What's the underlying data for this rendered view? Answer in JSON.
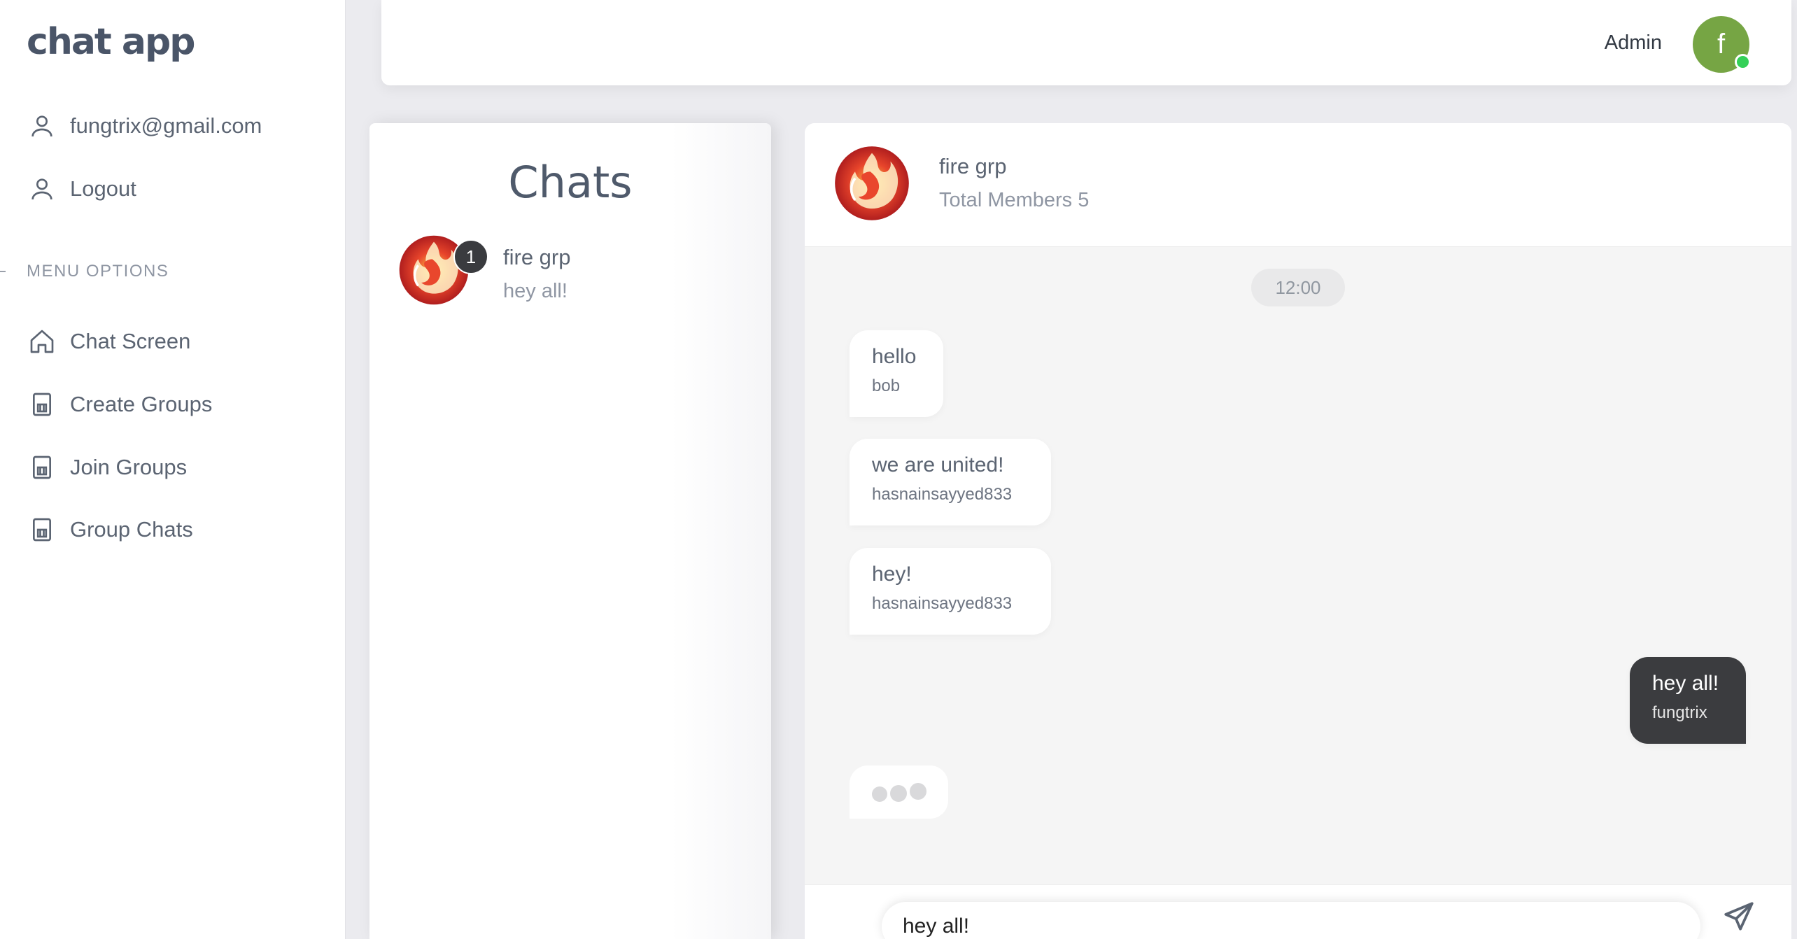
{
  "app": {
    "brand": "chat app"
  },
  "sidebar": {
    "user_email": "fungtrix@gmail.com",
    "logout_label": "Logout",
    "menu_heading": "MENU OPTIONS",
    "items": [
      {
        "label": "Chat Screen",
        "icon": "home-icon"
      },
      {
        "label": "Create Groups",
        "icon": "document-icon"
      },
      {
        "label": "Join Groups",
        "icon": "document-icon"
      },
      {
        "label": "Group Chats",
        "icon": "document-icon"
      }
    ]
  },
  "topbar": {
    "role_label": "Admin",
    "avatar_letter": "f",
    "avatar_color": "#76a544",
    "status": "online"
  },
  "chats": {
    "title": "Chats",
    "list": [
      {
        "name": "fire grp",
        "last_message": "hey all!",
        "unread": "1"
      }
    ]
  },
  "conversation": {
    "group_name": "fire grp",
    "members_label": "Total Members 5",
    "time_divider": "12:00",
    "messages": [
      {
        "text": "hello",
        "sender": "bob",
        "mine": false
      },
      {
        "text": "we are united!",
        "sender": "hasnainsayyed833",
        "mine": false
      },
      {
        "text": "hey!",
        "sender": "hasnainsayyed833",
        "mine": false
      },
      {
        "text": "hey all!",
        "sender": "fungtrix",
        "mine": true
      }
    ],
    "typing_indicator": true,
    "composer_value": "hey all!"
  },
  "colors": {
    "sent_bubble": "#3b3c3f",
    "received_bubble": "#ffffff",
    "badge": "#3a3b3f"
  }
}
